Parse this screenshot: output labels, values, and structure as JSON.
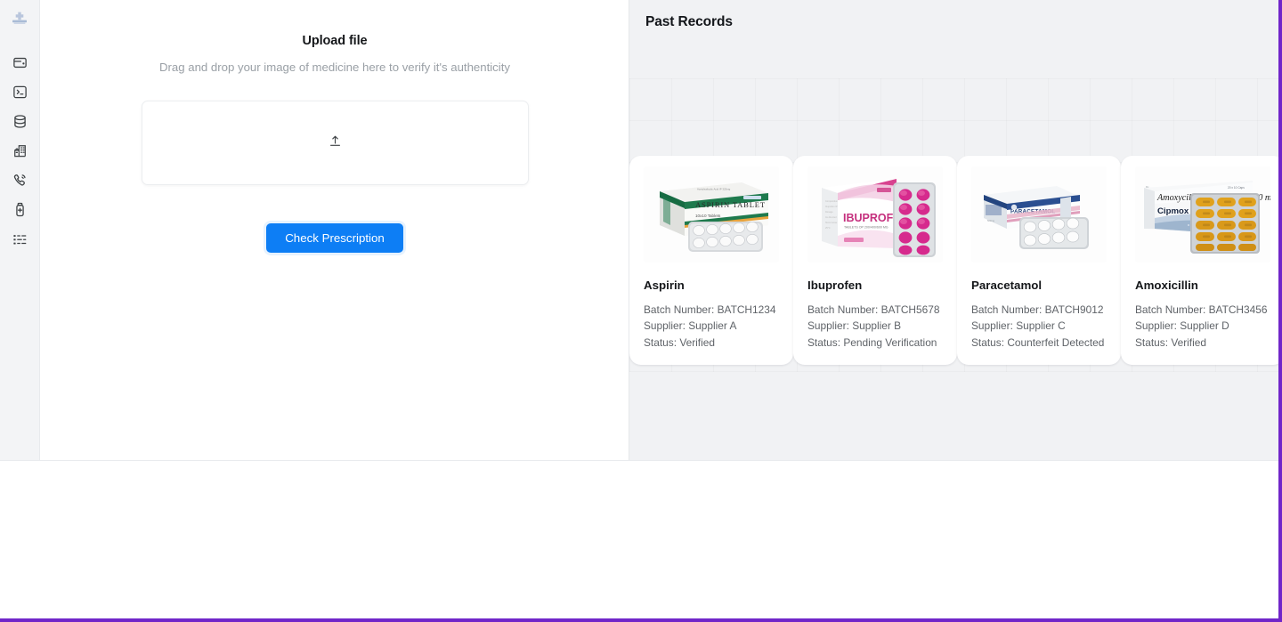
{
  "window": {
    "focus_outline_color": "#7126c9",
    "app_background": "#f1f2f4",
    "panel_background": "#ffffff"
  },
  "sidebar": {
    "logo_icon": "medical-cross-logo-icon",
    "items": [
      {
        "icon": "wallet-icon",
        "name": "sidebar-item-wallet"
      },
      {
        "icon": "terminal-icon",
        "name": "sidebar-item-terminal"
      },
      {
        "icon": "database-icon",
        "name": "sidebar-item-database"
      },
      {
        "icon": "buildings-icon",
        "name": "sidebar-item-buildings"
      },
      {
        "icon": "phone-call-icon",
        "name": "sidebar-item-phone"
      },
      {
        "icon": "medicine-bottle-icon",
        "name": "sidebar-item-medicine"
      },
      {
        "icon": "list-icon",
        "name": "sidebar-item-list"
      }
    ]
  },
  "upload": {
    "title": "Upload file",
    "subtitle": "Drag and drop your image of medicine here to verify it's authenticity",
    "dropzone_icon": "upload-icon",
    "dropzone_hint": "",
    "button_label": "Check Prescription",
    "button_color": "#0d7ef5"
  },
  "records": {
    "title": "Past Records",
    "labels": {
      "batch_prefix": "Batch Number: ",
      "supplier_prefix": "Supplier: ",
      "status_prefix": "Status: "
    },
    "cards": [
      {
        "name": "Aspirin",
        "batch": "Batch Number: BATCH1234",
        "supplier": "Supplier: Supplier A",
        "status": "Status: Verified",
        "thumb": "aspirin-tablet-box-photo"
      },
      {
        "name": "Ibuprofen",
        "batch": "Batch Number: BATCH5678",
        "supplier": "Supplier: Supplier B",
        "status": "Status: Pending Verification",
        "thumb": "ibuprofen-tablet-box-photo"
      },
      {
        "name": "Paracetamol",
        "batch": "Batch Number: BATCH9012",
        "supplier": "Supplier: Supplier C",
        "status": "Status: Counterfeit Detected",
        "thumb": "paracetamol-tablet-box-photo"
      },
      {
        "name": "Amoxicillin",
        "batch": "Batch Number: BATCH3456",
        "supplier": "Supplier: Supplier D",
        "status": "Status: Verified",
        "thumb": "amoxicillin-capsules-box-photo"
      }
    ]
  }
}
